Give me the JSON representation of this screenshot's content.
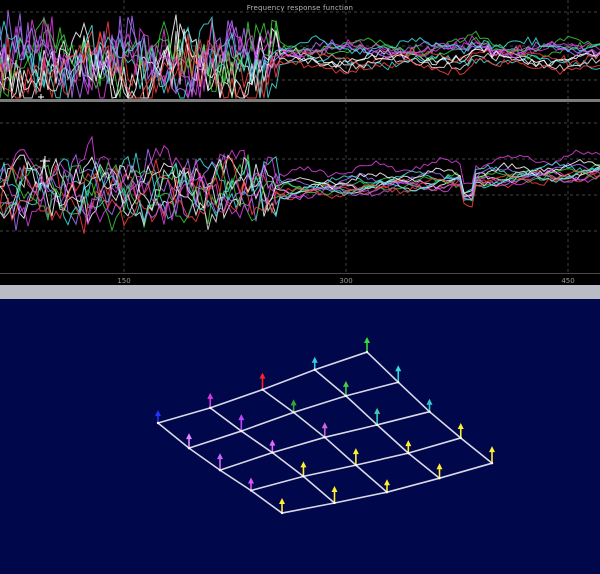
{
  "frf": {
    "title": "Frequency response function",
    "x_ticks": [
      "150",
      "300",
      "450"
    ]
  },
  "colors": {
    "plot_background": "#000000",
    "model_background": "#00074a",
    "separator": "#b9bcc5",
    "trace_colors": [
      "#ffffff",
      "#3ad03a",
      "#e040e0",
      "#b070ff",
      "#40e0e0",
      "#ff4040",
      "#e8e8e8"
    ]
  },
  "model": {
    "grid": "5 x 5 node plate mesh",
    "arrow_colors_by_row": [
      [
        "#2233ff",
        "#dd33dd",
        "#ff2222",
        "#33ccdd",
        "#33dd33"
      ],
      [
        "#dd88ff",
        "#bb44ff",
        "#33aa33",
        "#44cc44",
        "#33dddd"
      ],
      [
        "#cc66ff",
        "#ee66ff",
        "#cc66dd",
        "#44ccaa",
        "#33cccc"
      ],
      [
        "#dd55ff",
        "#ffee33",
        "#ffee33",
        "#ffee33",
        "#ffee33"
      ],
      [
        "#ffee33",
        "#ffee33",
        "#ffee33",
        "#ffee33",
        "#ffee33"
      ]
    ]
  }
}
